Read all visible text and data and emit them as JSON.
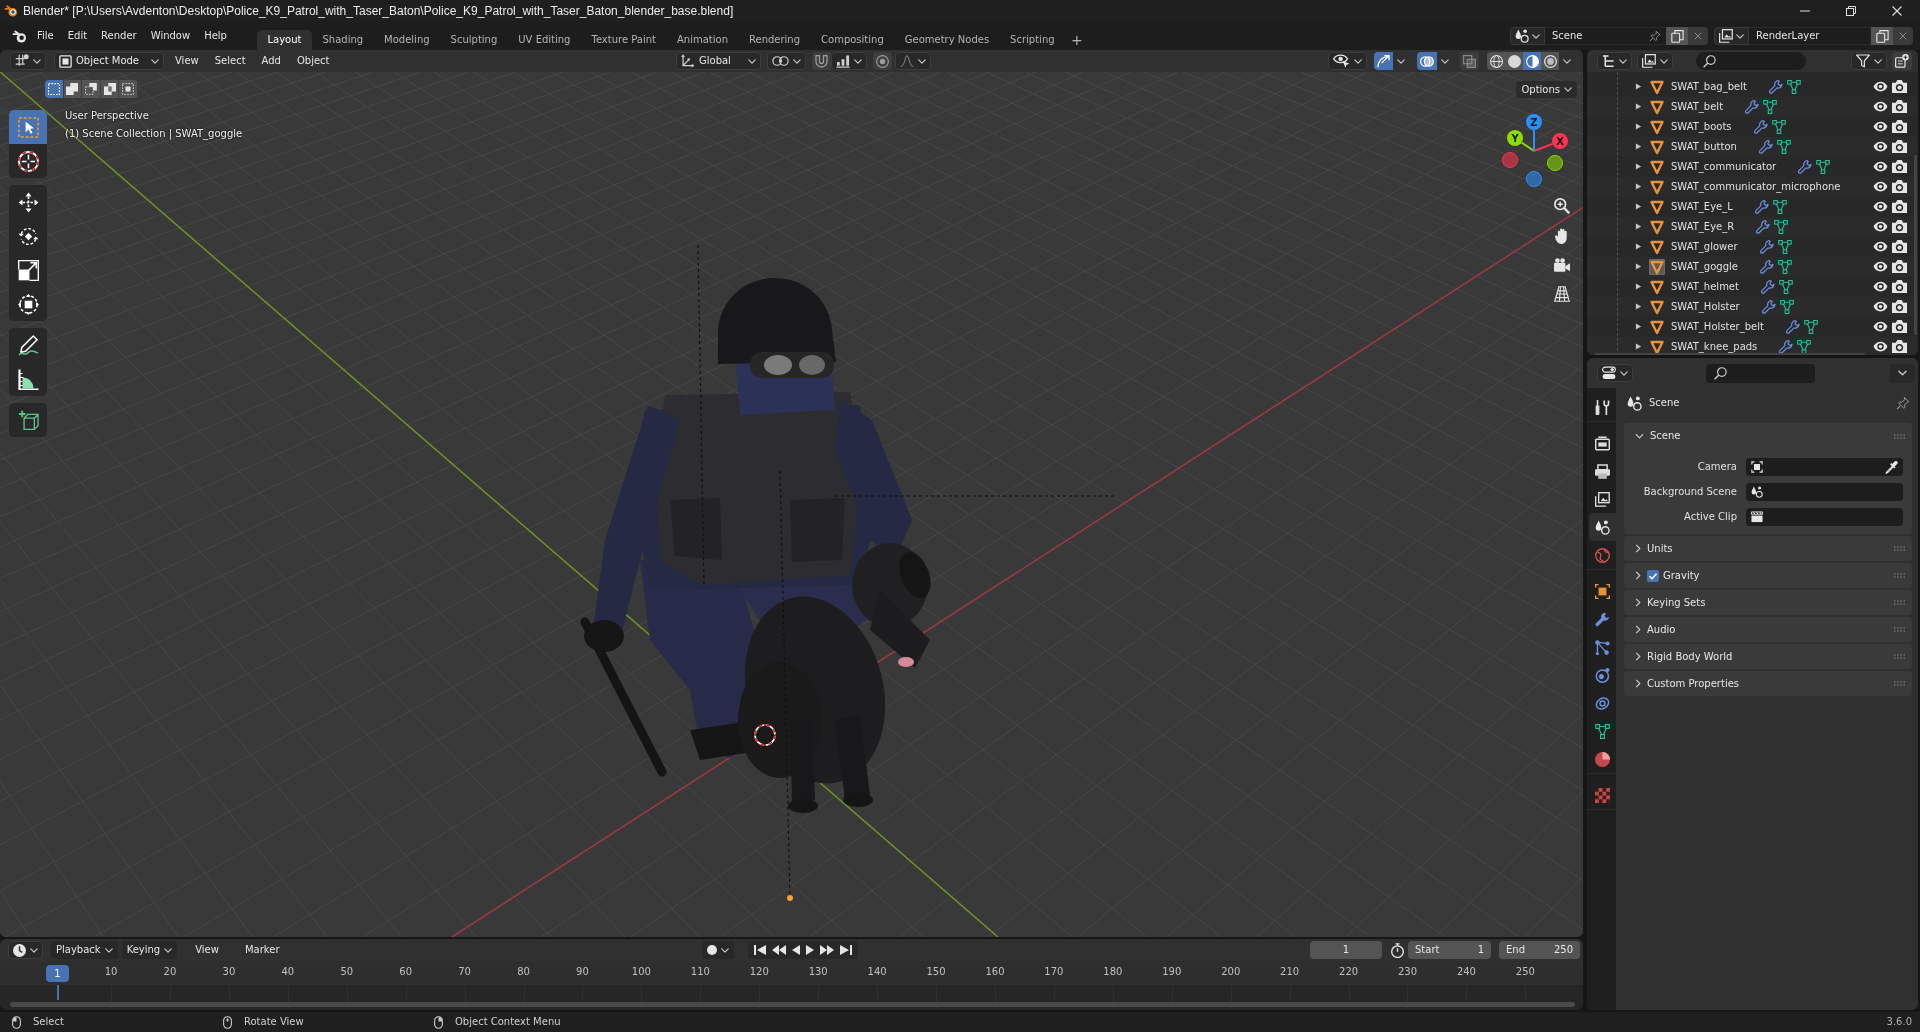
{
  "window": {
    "title": "Blender* [P:\\Users\\Avdenton\\Desktop\\Police_K9_Patrol_with_Taser_Baton\\Police_K9_Patrol_with_Taser_Baton_blender_base.blend]"
  },
  "menu_bar": [
    "File",
    "Edit",
    "Render",
    "Window",
    "Help"
  ],
  "workspace_tabs": [
    {
      "label": "Layout",
      "selected": true
    },
    {
      "label": "Shading",
      "selected": false
    },
    {
      "label": "Modeling",
      "selected": false
    },
    {
      "label": "Sculpting",
      "selected": false
    },
    {
      "label": "UV Editing",
      "selected": false
    },
    {
      "label": "Texture Paint",
      "selected": false
    },
    {
      "label": "Animation",
      "selected": false
    },
    {
      "label": "Rendering",
      "selected": false
    },
    {
      "label": "Compositing",
      "selected": false
    },
    {
      "label": "Geometry Nodes",
      "selected": false
    },
    {
      "label": "Scripting",
      "selected": false
    }
  ],
  "add_workspace": "+",
  "scene": {
    "value": "Scene"
  },
  "view_layer": {
    "value": "RenderLayer"
  },
  "viewport": {
    "mode": "Object Mode",
    "menus": [
      "View",
      "Select",
      "Add",
      "Object"
    ],
    "orientation": "Global",
    "snap": {
      "on": false
    },
    "proportional": {
      "on": false
    },
    "gizmos": {
      "on": true
    },
    "overlays": {
      "on": true
    },
    "xray": {
      "on": false
    },
    "shading": [
      {
        "kind": "wireframe",
        "selected": false
      },
      {
        "kind": "solid",
        "selected": false
      },
      {
        "kind": "material",
        "selected": true
      },
      {
        "kind": "rendered",
        "selected": false
      }
    ],
    "select_modes": [
      {
        "kind": "set",
        "selected": true
      },
      {
        "kind": "extend",
        "selected": false
      },
      {
        "kind": "subtract",
        "selected": false
      },
      {
        "kind": "invert",
        "selected": false
      },
      {
        "kind": "intersect",
        "selected": false
      }
    ],
    "tool_groups": [
      [
        {
          "kind": "select_box",
          "selected": true
        },
        {
          "kind": "cursor",
          "selected": false
        }
      ],
      [
        {
          "kind": "move",
          "selected": false
        },
        {
          "kind": "rotate",
          "selected": false
        },
        {
          "kind": "scale",
          "selected": false
        },
        {
          "kind": "transform",
          "selected": false
        }
      ],
      [
        {
          "kind": "annotate",
          "selected": false
        },
        {
          "kind": "measure",
          "selected": false
        }
      ],
      [
        {
          "kind": "add_cube",
          "selected": false
        }
      ]
    ],
    "info": [
      "User Perspective",
      "(1) Scene Collection | SWAT_goggle"
    ],
    "options": "Options",
    "navigation_gizmo": [
      {
        "label": "X",
        "color": "#ff3352"
      },
      {
        "label": "Y",
        "color": "#8bdc00"
      },
      {
        "label": "Z",
        "color": "#2890ff"
      }
    ]
  },
  "outliner": {
    "items": [
      {
        "name": "SWAT_bag_belt",
        "expanded": false,
        "active": false,
        "child_icons": true
      },
      {
        "name": "SWAT_belt",
        "expanded": false,
        "active": false,
        "child_icons": true
      },
      {
        "name": "SWAT_boots",
        "expanded": false,
        "active": false,
        "child_icons": true
      },
      {
        "name": "SWAT_button",
        "expanded": false,
        "active": false,
        "child_icons": true
      },
      {
        "name": "SWAT_communicator",
        "expanded": false,
        "active": false,
        "child_icons": true
      },
      {
        "name": "SWAT_communicator_microphone",
        "expanded": false,
        "active": false,
        "child_icons": false
      },
      {
        "name": "SWAT_Eye_L",
        "expanded": false,
        "active": false,
        "child_icons": true
      },
      {
        "name": "SWAT_Eye_R",
        "expanded": false,
        "active": false,
        "child_icons": true
      },
      {
        "name": "SWAT_glower",
        "expanded": false,
        "active": false,
        "child_icons": true
      },
      {
        "name": "SWAT_goggle",
        "expanded": false,
        "active": true,
        "child_icons": true
      },
      {
        "name": "SWAT_helmet",
        "expanded": false,
        "active": false,
        "child_icons": true
      },
      {
        "name": "SWAT_Holster",
        "expanded": false,
        "active": false,
        "child_icons": true
      },
      {
        "name": "SWAT_Holster_belt",
        "expanded": false,
        "active": false,
        "child_icons": true
      },
      {
        "name": "SWAT_knee_pads",
        "expanded": false,
        "active": false,
        "child_icons": true
      }
    ]
  },
  "properties": {
    "tab_groups": [
      [
        {
          "kind": "tool",
          "selected": false
        }
      ],
      [
        {
          "kind": "render",
          "selected": false
        },
        {
          "kind": "output",
          "selected": false
        },
        {
          "kind": "view_layer",
          "selected": false
        },
        {
          "kind": "scene",
          "selected": true
        },
        {
          "kind": "world",
          "selected": false
        }
      ],
      [
        {
          "kind": "object",
          "selected": false
        },
        {
          "kind": "modifiers",
          "selected": false
        },
        {
          "kind": "particles",
          "selected": false
        },
        {
          "kind": "physics",
          "selected": false
        },
        {
          "kind": "constraints",
          "selected": false
        },
        {
          "kind": "data",
          "selected": false
        },
        {
          "kind": "material",
          "selected": false
        }
      ],
      [
        {
          "kind": "texture",
          "selected": false
        }
      ]
    ],
    "context": "Scene",
    "panels": [
      {
        "title": "Scene",
        "expanded": true,
        "fields": [
          {
            "label": "Camera",
            "kind": "object"
          },
          {
            "label": "Background Scene",
            "kind": "scene"
          },
          {
            "label": "Active Clip",
            "kind": "clip"
          }
        ]
      },
      {
        "title": "Units",
        "expanded": false
      },
      {
        "title": "Gravity",
        "expanded": false,
        "checkbox": {
          "checked": true
        }
      },
      {
        "title": "Keying Sets",
        "expanded": false
      },
      {
        "title": "Audio",
        "expanded": false
      },
      {
        "title": "Rigid Body World",
        "expanded": false
      },
      {
        "title": "Custom Properties",
        "expanded": false
      }
    ]
  },
  "timeline": {
    "menus": [
      "Playback",
      "Keying",
      "View",
      "Marker"
    ],
    "current_frame": "1",
    "start": {
      "label": "Start",
      "value": "1"
    },
    "end": {
      "label": "End",
      "value": "250"
    },
    "playhead": "1",
    "ruler": [
      "10",
      "20",
      "30",
      "40",
      "50",
      "60",
      "70",
      "80",
      "90",
      "100",
      "110",
      "120",
      "130",
      "140",
      "150",
      "160",
      "170",
      "180",
      "190",
      "200",
      "210",
      "220",
      "230",
      "240",
      "250"
    ]
  },
  "status_bar": {
    "hints": [
      {
        "kind": "left_click",
        "label": "Select"
      },
      {
        "kind": "middle_click",
        "label": "Rotate View"
      },
      {
        "kind": "right_click",
        "label": "Object Context Menu"
      }
    ],
    "version": "3.6.0"
  }
}
